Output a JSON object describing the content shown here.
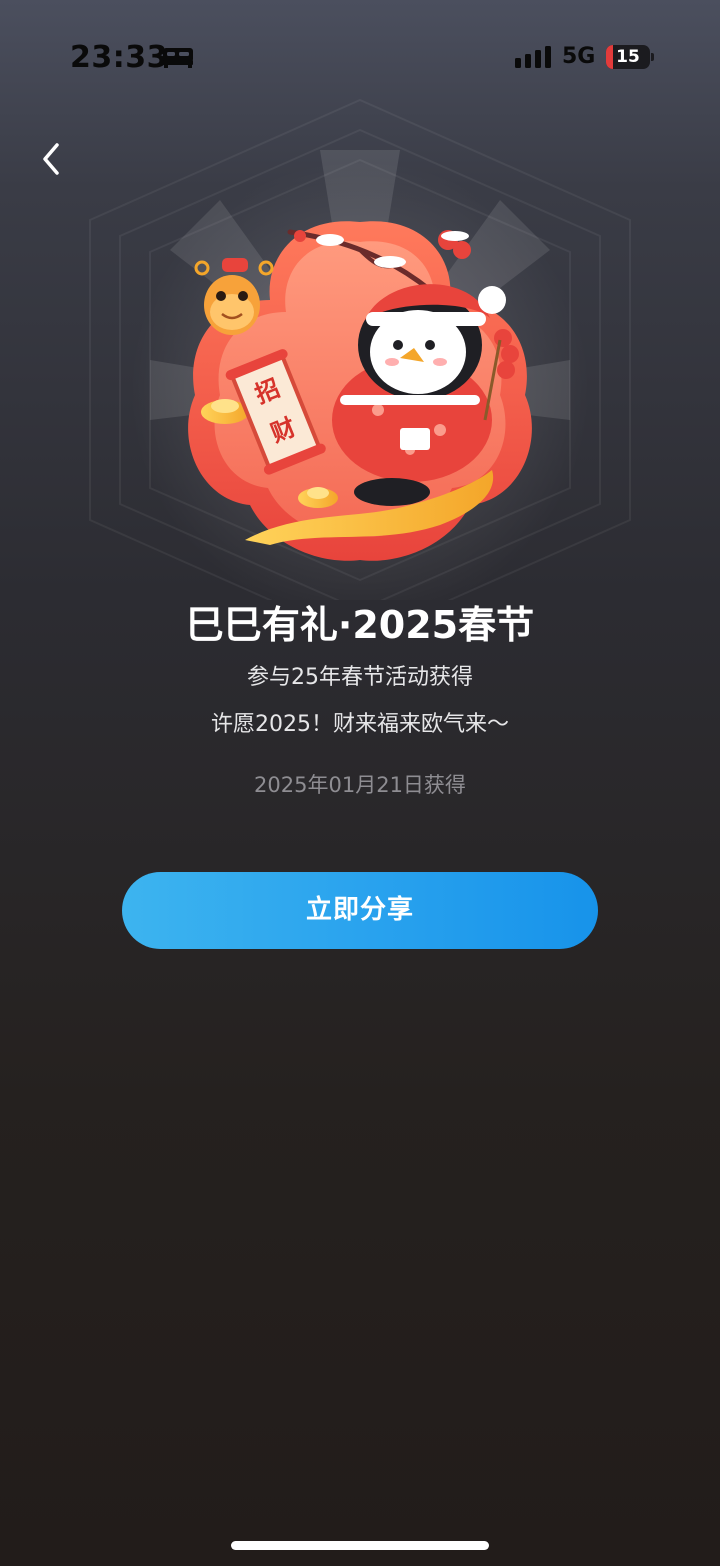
{
  "status_bar": {
    "time": "23:33",
    "network": "5G",
    "battery_level": "15",
    "battery_fraction": 0.15,
    "sleep_icon": "bed-icon",
    "signal_icon": "cellular-signal-icon"
  },
  "nav": {
    "back_icon": "chevron-left-icon"
  },
  "badge": {
    "scroll_text": "招财",
    "title": "巳巳有礼·2025春节",
    "description_1": "参与25年春节活动获得",
    "description_2": "许愿2025！财来福来欧气来～",
    "obtained_date": "2025年01月21日获得"
  },
  "actions": {
    "share_label": "立即分享"
  },
  "colors": {
    "share_gradient_start": "#3db4ef",
    "share_gradient_end": "#1793ea",
    "badge_red": "#f0554a",
    "badge_gold": "#f7b733",
    "battery_low": "#e23b3b"
  }
}
